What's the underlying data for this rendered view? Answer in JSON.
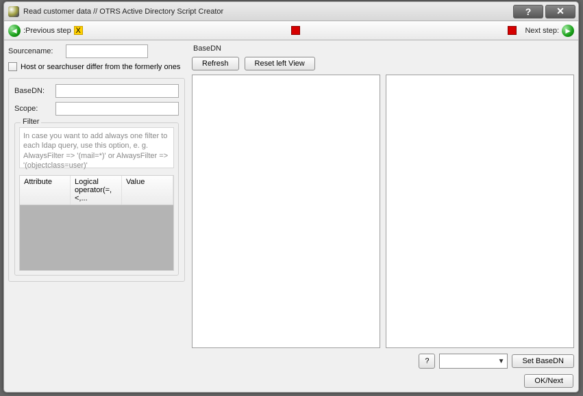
{
  "window": {
    "title": "Read customer data // OTRS Active Directory Script Creator"
  },
  "nav": {
    "prev_label": ":Previous step",
    "next_label": "Next step:"
  },
  "left": {
    "sourcename_label": "Sourcename:",
    "sourcename_value": "",
    "host_checkbox_label": "Host or searchuser differ from the formerly ones",
    "basedn_label": "BaseDN:",
    "basedn_value": "",
    "scope_label": "Scope:",
    "scope_value": "",
    "filter_legend": "Filter",
    "filter_hint": "In case you want to add always one filter to each ldap query, use this option, e. g. AlwaysFilter => '(mail=*)' or AlwaysFilter => '(objectclass=user)'",
    "table": {
      "col_attribute": "Attribute",
      "col_operator": "Logical operator(=,<,...",
      "col_value": "Value"
    }
  },
  "right": {
    "basedn_label": "BaseDN",
    "refresh_btn": "Refresh",
    "reset_btn": "Reset left View",
    "help_btn": "?",
    "combo_value": "",
    "set_basedn_btn": "Set BaseDN",
    "ok_next_btn": "OK/Next"
  }
}
